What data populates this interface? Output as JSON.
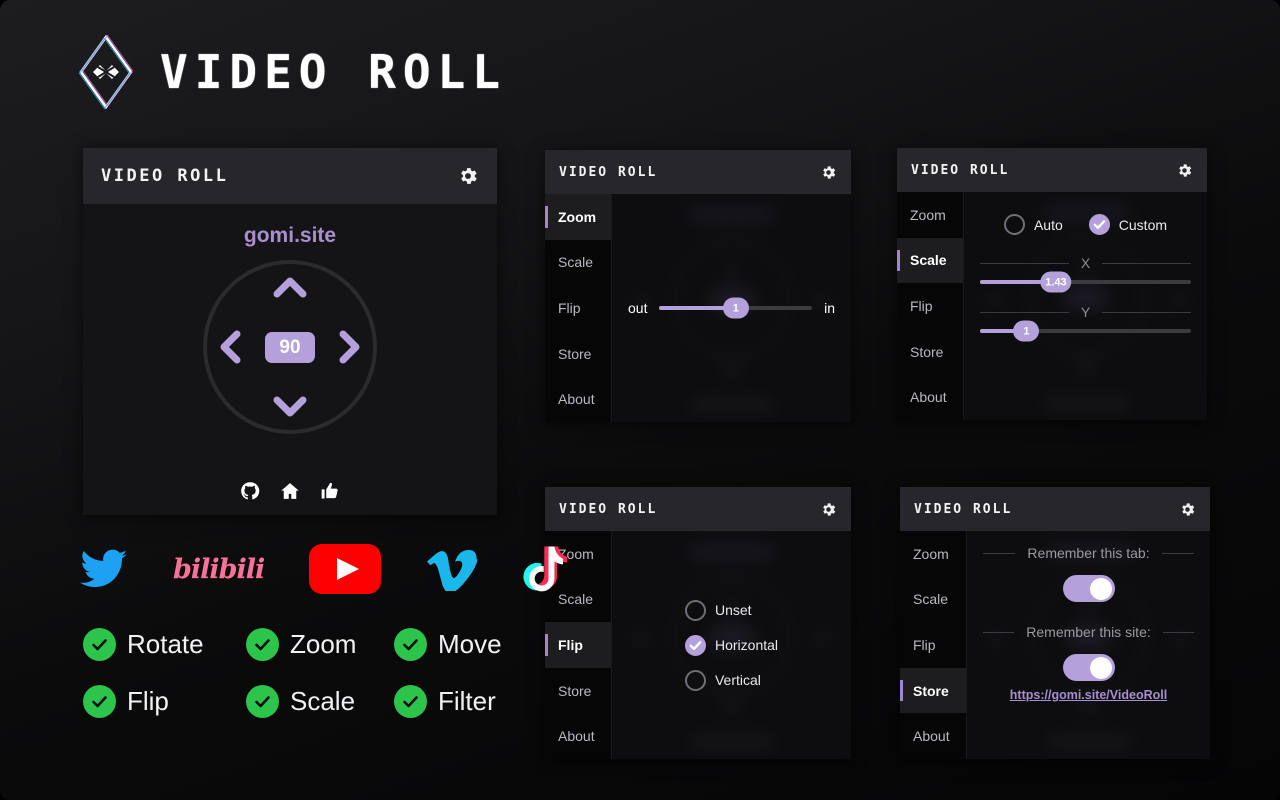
{
  "brand": {
    "title": "VIDEO ROLL",
    "logo_icon": "diamond-logo-icon"
  },
  "main_popup": {
    "title": "VIDEO ROLL",
    "gear_icon": "gear-icon",
    "site_name": "gomi.site",
    "rotation_value": "90",
    "arrows": {
      "up": "chevron-up-icon",
      "down": "chevron-down-icon",
      "left": "chevron-left-icon",
      "right": "chevron-right-icon"
    },
    "footer_icons": [
      "github-icon",
      "home-icon",
      "thumbs-up-icon"
    ]
  },
  "nav_items": [
    "Zoom",
    "Scale",
    "Flip",
    "Store",
    "About"
  ],
  "zoom_popup": {
    "title": "VIDEO ROLL",
    "gear_icon": "gear-icon",
    "active_tab": "Zoom",
    "slider": {
      "min_label": "out",
      "max_label": "in",
      "value": "1",
      "fill_percent": 50
    }
  },
  "scale_popup": {
    "title": "VIDEO ROLL",
    "gear_icon": "gear-icon",
    "active_tab": "Scale",
    "mode_options": [
      {
        "label": "Auto",
        "checked": false
      },
      {
        "label": "Custom",
        "checked": true
      }
    ],
    "axes": [
      {
        "label": "X",
        "value": "1.43",
        "fill_percent": 36
      },
      {
        "label": "Y",
        "value": "1",
        "fill_percent": 22
      }
    ]
  },
  "flip_popup": {
    "title": "VIDEO ROLL",
    "gear_icon": "gear-icon",
    "active_tab": "Flip",
    "options": [
      {
        "label": "Unset",
        "checked": false
      },
      {
        "label": "Horizontal",
        "checked": true
      },
      {
        "label": "Vertical",
        "checked": false
      }
    ]
  },
  "store_popup": {
    "title": "VIDEO ROLL",
    "gear_icon": "gear-icon",
    "active_tab": "Store",
    "remember_tab_label": "Remember this tab:",
    "remember_tab_on": true,
    "remember_site_label": "Remember this site:",
    "remember_site_on": true,
    "site_link": "https://gomi.site/VideoRoll"
  },
  "socials": [
    {
      "name": "twitter-icon",
      "label": "Twitter",
      "color": "#1da1f2"
    },
    {
      "name": "bilibili-icon",
      "label": "bilibili",
      "color": "#fb7299"
    },
    {
      "name": "youtube-icon",
      "label": "YouTube",
      "color": "#ff0000"
    },
    {
      "name": "vimeo-icon",
      "label": "Vimeo",
      "color": "#1ab7ea"
    },
    {
      "name": "tiktok-icon",
      "label": "TikTok",
      "color": "#fe2c55"
    }
  ],
  "features": [
    {
      "label": "Rotate"
    },
    {
      "label": "Zoom"
    },
    {
      "label": "Move"
    },
    {
      "label": "Flip"
    },
    {
      "label": "Scale"
    },
    {
      "label": "Filter"
    }
  ],
  "colors": {
    "accent_purple": "#b4a0db",
    "link_purple": "#a78fd0",
    "check_green": "#2cc44b",
    "panel_header": "#27272b",
    "panel_body": "#0d0d0f"
  }
}
